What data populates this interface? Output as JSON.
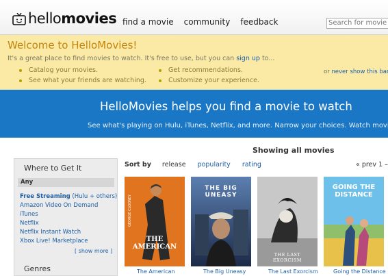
{
  "header": {
    "logo_light": "hello",
    "logo_bold": "movies",
    "nav": [
      "find a movie",
      "community",
      "feedback"
    ],
    "search_placeholder": "Search for movie or cast"
  },
  "welcome": {
    "title": "Welcome to HelloMovies!",
    "intro_prefix": "It's a great place to find movies to watch. It's free to use, but you can ",
    "intro_link": "sign up",
    "intro_suffix": " to...",
    "bullets_left": [
      "Catalog your movies.",
      "See what your friends are watching."
    ],
    "bullets_right": [
      "Get recommendations.",
      "Customize your experience."
    ],
    "dismiss_prefix": "or ",
    "dismiss_link": "never show this banner"
  },
  "banner": {
    "headline": "HelloMovies helps you find a movie to watch",
    "sub": "See what's playing on Hulu, iTunes, Netflix, and more. Narrow your choices. Watch movies."
  },
  "results": {
    "heading": "Showing all movies"
  },
  "sidebar": {
    "title": "Where to Get It",
    "any": "Any",
    "free_bold": "Free Streaming",
    "free_rest": " (Hulu + others)",
    "items": [
      "Amazon Video On Demand",
      "iTunes",
      "Netflix",
      "Netflix Instant Watch",
      "Xbox Live! Marketplace"
    ],
    "more": "[ show more ]",
    "genres_title": "Genres"
  },
  "sort": {
    "label": "Sort by",
    "options": [
      "release",
      "popularity",
      "rating"
    ]
  },
  "pager": {
    "prev": "« prev",
    "page": "1 –"
  },
  "posters": [
    {
      "caption": "The American",
      "tagline": "GEORGE CLOONEY",
      "title": "THE AMERICAN",
      "bg": "#e0741f"
    },
    {
      "caption": "The Big Uneasy",
      "tagline": "",
      "title": "THE BIG UNEASY",
      "bg": "#2a3f6a"
    },
    {
      "caption": "The Last Exorcism",
      "tagline": "",
      "title": "THE LAST EXORCISM",
      "bg": "#bfbfbf"
    },
    {
      "caption": "Going the Distance",
      "tagline": "",
      "title": "GOING THE DISTANCE",
      "bg": "#5fb3e0"
    }
  ],
  "colors": {
    "accent": "#1a77c5",
    "welcome_bg": "#fbe9a6",
    "link": "#1b5ea6"
  }
}
